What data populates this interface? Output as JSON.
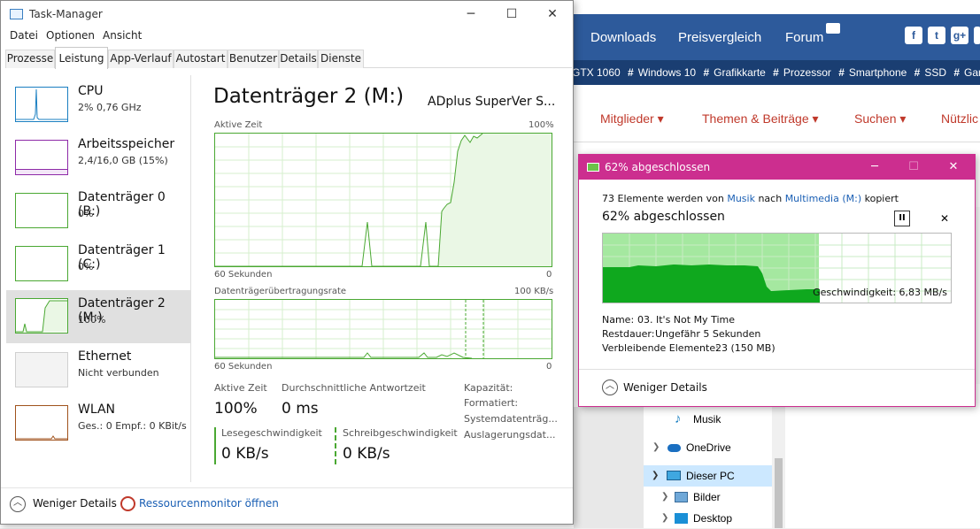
{
  "website": {
    "nav": [
      "Downloads",
      "Preisvergleich",
      "Forum"
    ],
    "social": [
      "f",
      "t",
      "g+",
      "in"
    ],
    "tags": [
      "GTX 1060",
      "Windows 10",
      "Grafikkarte",
      "Prozessor",
      "Smartphone",
      "SSD",
      "Gam"
    ],
    "subnav": [
      "Mitglieder ▾",
      "Themen & Beiträge ▾",
      "Suchen ▾",
      "Nützlic"
    ],
    "explorer": [
      {
        "label": "Musik",
        "icon": "music-icon",
        "expandable": false,
        "selected": false
      },
      {
        "label": "OneDrive",
        "icon": "cloud-icon",
        "expandable": true,
        "selected": false
      },
      {
        "label": "Dieser PC",
        "icon": "pc-icon",
        "expandable": true,
        "selected": true
      },
      {
        "label": "Bilder",
        "icon": "pictures-icon",
        "expandable": true,
        "selected": false
      },
      {
        "label": "Desktop",
        "icon": "desktop-icon",
        "expandable": true,
        "selected": false
      }
    ]
  },
  "taskmanager": {
    "title": "Task-Manager",
    "menu": [
      "Datei",
      "Optionen",
      "Ansicht"
    ],
    "tabs": [
      "Prozesse",
      "Leistung",
      "App-Verlauf",
      "Autostart",
      "Benutzer",
      "Details",
      "Dienste"
    ],
    "active_tab": "Leistung",
    "resources": [
      {
        "name": "CPU",
        "detail": "2% 0,76 GHz",
        "color": "#1a7fc1"
      },
      {
        "name": "Arbeitsspeicher",
        "detail": "2,4/16,0 GB (15%)",
        "color": "#8e2aa8"
      },
      {
        "name": "Datenträger 0 (B:)",
        "detail": "0%",
        "color": "#4aa832"
      },
      {
        "name": "Datenträger 1 (C:)",
        "detail": "0%",
        "color": "#4aa832"
      },
      {
        "name": "Datenträger 2 (M:)",
        "detail": "100%",
        "color": "#4aa832"
      },
      {
        "name": "Ethernet",
        "detail": "Nicht verbunden",
        "color": "#b0b0b0"
      },
      {
        "name": "WLAN",
        "detail": "Ges.: 0 Empf.: 0 KBit/s",
        "color": "#a0521c"
      }
    ],
    "selected_resource": "Datenträger 2 (M:)",
    "disk": {
      "title": "Datenträger 2 (M:)",
      "model": "ADplus SuperVer S...",
      "graph1_label": "Aktive Zeit",
      "graph1_max": "100%",
      "graph1_time": "60 Sekunden",
      "graph1_min": "0",
      "graph2_label": "Datenträgerübertragungsrate",
      "graph2_max": "100 KB/s",
      "graph2_time": "60 Sekunden",
      "graph2_min": "0",
      "active_time_label": "Aktive Zeit",
      "active_time_value": "100%",
      "response_label": "Durchschnittliche Antwortzeit",
      "response_value": "0 ms",
      "read_label": "Lesegeschwindigkeit",
      "read_value": "0 KB/s",
      "write_label": "Schreibgeschwindigkeit",
      "write_value": "0 KB/s",
      "props": [
        "Kapazität:",
        "Formatiert:",
        "Systemdatenträg...",
        "Auslagerungsdat..."
      ]
    },
    "footer": {
      "less_details": "Weniger Details",
      "resource_monitor": "Ressourcenmonitor öffnen"
    }
  },
  "copy_dialog": {
    "title": "62% abgeschlossen",
    "line_prefix": "73 Elemente werden von ",
    "source": "Musik",
    "line_mid": " nach ",
    "destination": "Multimedia (M:)",
    "line_suffix": " kopiert",
    "status": "62% abgeschlossen",
    "progress": 0.62,
    "speed": "Geschwindigkeit: 6,83 MB/s",
    "name_label": "Name:",
    "name_value": "03. It's Not My Time",
    "remaining_time_label": "Restdauer:",
    "remaining_time_value": "Ungefähr 5 Sekunden",
    "remaining_items_label": "Verbleibende Elemente:",
    "remaining_items_value": "23 (150 MB)",
    "less_details": "Weniger Details"
  }
}
